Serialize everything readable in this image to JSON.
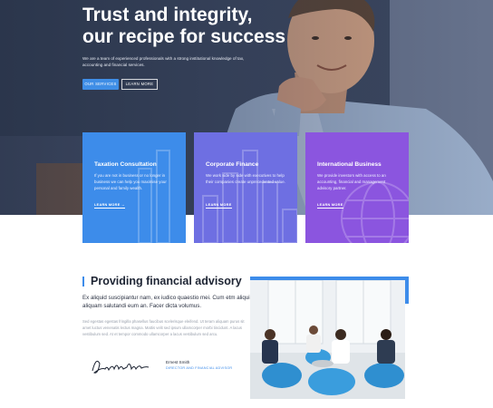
{
  "hero": {
    "title_line1": "Trust and integrity,",
    "title_line2": "our recipe for success",
    "description": "We are a team of experienced professionals with a strong institutional knowledge of tax, accounting and financial services.",
    "primary_button": "OUR SERVICES",
    "secondary_button": "LEARN MORE"
  },
  "cards": [
    {
      "title": "Taxation Consultation",
      "text": "If you are not in business or no longer in business we can help you maximise your personal and family wealth.",
      "link": "LEARN MORE →"
    },
    {
      "title": "Corporate Finance",
      "text": "We work side by side with executives to help their companies create unprecedented value.",
      "link": "LEARN MORE"
    },
    {
      "title": "International Business",
      "text": "We provide investors with access to an accounting, financial and management advisory partner.",
      "link": "LEARN MORE"
    }
  ],
  "advisory": {
    "title": "Providing financial advisory",
    "lead": "Ex aliquid suscipiantur nam, ex iudico quaestio mei. Cum etm aliquip aliquam salutandi eum an. Facer dicta volumus.",
    "body": "Sed egestas egestas fringilla phasellus faucibus scelerisque eleifend. Ut teram aliquam purus sit amet luctus venenatis lectus magna. Mattis velit sed ipsum ullamcorper morbi tincidunt. A lacus vestibulum sed. At et tempor commodo ullamcorper a lacus vestibulum sed arcu.",
    "signer_name": "Ernest Smith",
    "signer_role": "DIRECTOR AND FINANCIAL ADVISOR"
  },
  "colors": {
    "accent": "#3d8cea",
    "card_blue": "#3d8cea",
    "card_indigo": "#6e6fe2",
    "card_purple": "#8b55df"
  }
}
